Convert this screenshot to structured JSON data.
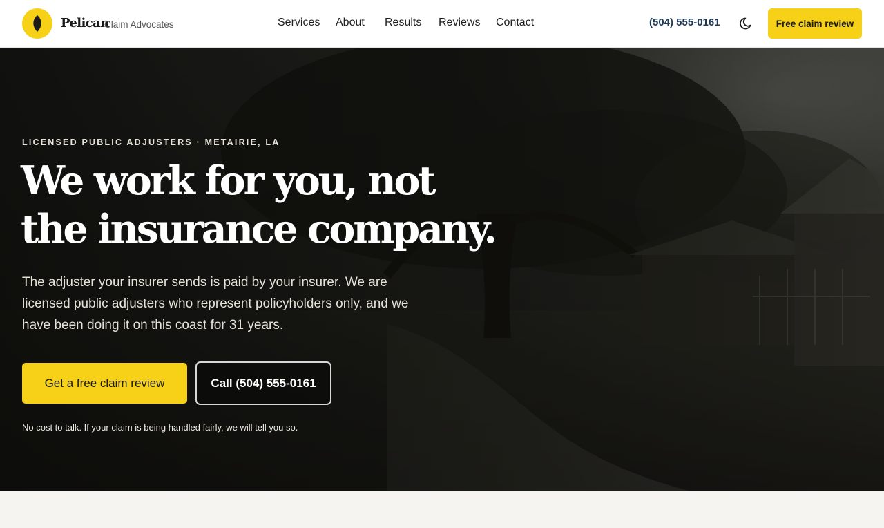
{
  "header": {
    "brand_name": "Pelican",
    "brand_sub": "Claim Advocates",
    "nav": [
      {
        "label": "Services"
      },
      {
        "label": "About"
      },
      {
        "label": "Results"
      },
      {
        "label": "Reviews"
      },
      {
        "label": "Contact"
      }
    ],
    "phone": "(504) 555-0161",
    "theme_icon": "moon-icon",
    "cta_label": "Free claim review"
  },
  "hero": {
    "eyebrow": "LICENSED PUBLIC ADJUSTERS · METAIRIE, LA",
    "headline_line1": "We work for you, not",
    "headline_line2": "the insurance company.",
    "description": "The adjuster your insurer sends is paid by your insurer. We are licensed public adjusters who represent policyholders only, and we have been doing it on this coast for 31 years.",
    "primary_cta": "Get a free claim review",
    "secondary_cta": "Call (504) 555-0161",
    "note": "No cost to talk. If your claim is being handled fairly, we will tell you so."
  },
  "colors": {
    "accent": "#f7d117",
    "phone_text": "#1d3a57",
    "hero_overlay": "#1e1d18",
    "page_background": "#f5f4f0"
  }
}
